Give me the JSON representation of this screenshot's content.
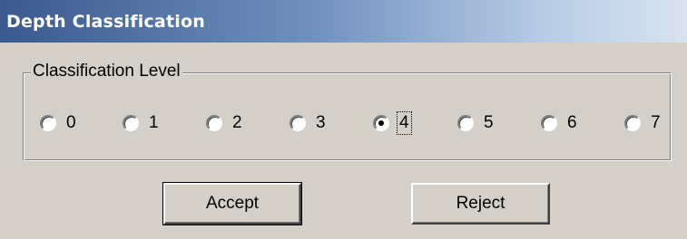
{
  "window": {
    "title": "Depth Classification"
  },
  "group": {
    "label": "Classification Level",
    "options": [
      {
        "label": "0",
        "checked": false
      },
      {
        "label": "1",
        "checked": false
      },
      {
        "label": "2",
        "checked": false
      },
      {
        "label": "3",
        "checked": false
      },
      {
        "label": "4",
        "checked": true
      },
      {
        "label": "5",
        "checked": false
      },
      {
        "label": "6",
        "checked": false
      },
      {
        "label": "7",
        "checked": false
      }
    ]
  },
  "buttons": {
    "accept_label": "Accept",
    "reject_label": "Reject"
  }
}
